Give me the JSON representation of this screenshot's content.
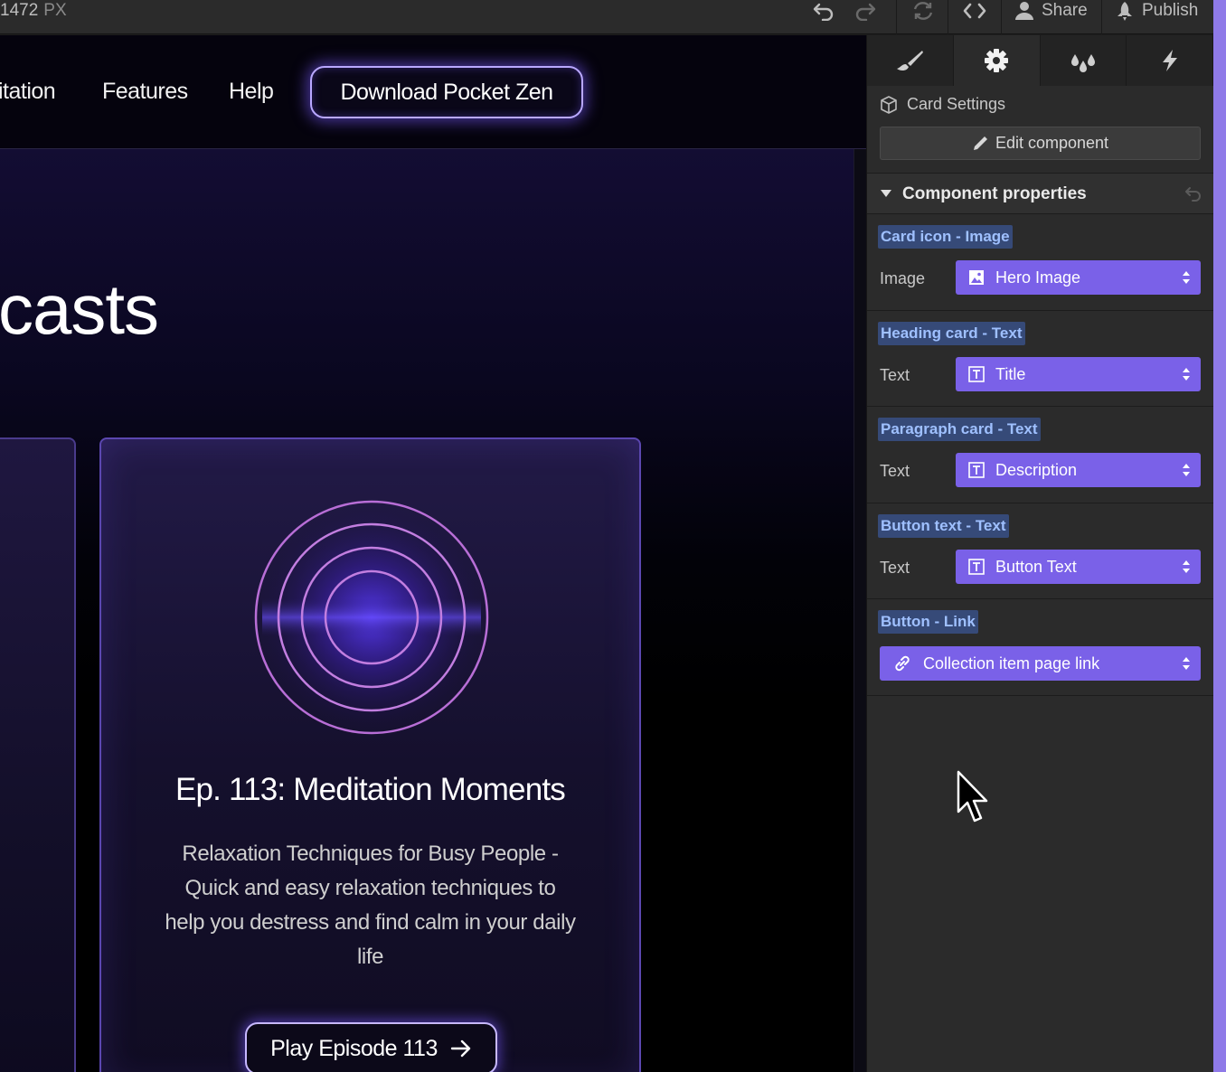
{
  "topbar": {
    "width_value": "1472",
    "width_unit": "PX",
    "share_label": "Share",
    "publish_label": "Publish"
  },
  "site": {
    "nav": {
      "links": [
        "itation",
        "Features",
        "Help"
      ],
      "cta": "Download Pocket Zen"
    },
    "hero_title": "casts",
    "card": {
      "title": "Ep. 113: Meditation Moments",
      "description": "Relaxation Techniques for Busy People - Quick and easy relaxation techniques to help you destress and find calm in your daily life",
      "button": "Play Episode 113"
    }
  },
  "panel": {
    "tabs": [
      "style-brush-icon",
      "settings-gear-icon",
      "interactions-drops-icon",
      "lightning-icon"
    ],
    "active_tab": "settings-gear-icon",
    "card_settings_label": "Card Settings",
    "edit_component_label": "Edit component",
    "section_title": "Component properties",
    "props": [
      {
        "tag": "Card icon - Image",
        "label": "Image",
        "value": "Hero Image",
        "icon": "image-icon"
      },
      {
        "tag": "Heading card - Text",
        "label": "Text",
        "value": "Title",
        "icon": "text-field-icon"
      },
      {
        "tag": "Paragraph card - Text",
        "label": "Text",
        "value": "Description",
        "icon": "text-field-icon"
      },
      {
        "tag": "Button text - Text",
        "label": "Text",
        "value": "Button Text",
        "icon": "text-field-icon"
      },
      {
        "tag": "Button - Link",
        "label": "",
        "value": "Collection item page link",
        "icon": "link-icon"
      }
    ]
  },
  "colors": {
    "accent_purple": "#7a61e8",
    "tag_bg": "#364a78",
    "tag_text": "#9fc0ff",
    "panel_bg": "#2b2b2b",
    "canvas_bg": "#000000"
  }
}
